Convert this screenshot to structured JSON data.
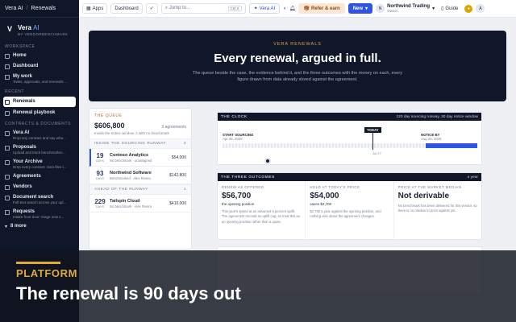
{
  "sidebar": {
    "header_app": "Vera AI",
    "header_page": "Renewals",
    "brand_name": "Vera",
    "brand_ai": "AI",
    "brand_sub": "BY VENDORBENCHMARK",
    "workspace_label": "WORKSPACE",
    "home": "Home",
    "dashboard": "Dashboard",
    "my_work": "My work",
    "my_work_desc": "Tasks, approvals, and renewals ...",
    "recent_label": "RECENT",
    "renewals": "Renewals",
    "renewal_playbook": "Renewal playbook",
    "contracts_label": "CONTRACTS & DOCUMENTS",
    "vera_ai": "Vera AI",
    "vera_ai_desc": "Drop any contract and say wha...",
    "proposals": "Proposals",
    "proposals_desc": "Upload and track benchmarkin...",
    "your_archive": "Your Archive",
    "your_archive_desc": "Drop every contract; Vera files t...",
    "agreements": "Agreements",
    "vendors": "Vendors",
    "document_search": "Document search",
    "document_search_desc": "Full-text search across your upl...",
    "requests": "Requests",
    "requests_desc": "Intake front door: triage new s...",
    "more": "8 more"
  },
  "topbar": {
    "apps": "Apps",
    "dashboard": "Dashboard",
    "search_placeholder": "Jump to...",
    "search_kbd": "Ctrl K",
    "vera_ai": "Vera AI",
    "refer": "Refer & earn",
    "new": "New",
    "org_initial": "N",
    "org_name": "Northwind Trading",
    "org_role": "Owner",
    "guide": "Guide",
    "user_initial": "A"
  },
  "hero": {
    "kicker": "VERA RENEWALS",
    "title": "Every renewal, argued in full.",
    "body": "The queue beside the case, the evidence behind it, and the three outcomes with the money on each, every figure drawn from data already stored against the agreement."
  },
  "queue": {
    "title": "THE QUEUE",
    "amount": "$606,800",
    "count": "3 agreements",
    "subtitle": "Inside the notice window, 2 with no benchmark",
    "group1": "INSIDE THE SOURCING RUNWAY",
    "group1_count": "2",
    "group2": "AHEAD OF THE RUNWAY",
    "group2_count": "1",
    "days_unit": "DAYS",
    "rows": [
      {
        "days": "19",
        "name": "Contoso Analytics",
        "status": "No benchmark · unassigned",
        "value": "$54,000"
      },
      {
        "days": "93",
        "name": "Northwind Software",
        "status": "Benchmarked · Alex Rivera",
        "value": "$142,800"
      },
      {
        "days": "229",
        "name": "Tailspin Cloud",
        "status": "No benchmark · Alex Rivera",
        "value": "$410,000"
      }
    ]
  },
  "clock": {
    "title": "THE CLOCK",
    "note": "120 day sourcing runway, 30 day notice window",
    "start_label": "START SOURCING",
    "start_date": "Apr 28, 2026",
    "today": "TODAY",
    "notice_label": "NOTICE BY",
    "notice_date": "Aug 26, 2026",
    "end_date": "Jul 27",
    "progress_fraction": 0.59
  },
  "outcomes": {
    "title": "THE THREE OUTCOMES",
    "note": "a year",
    "cols": [
      {
        "k": "RENEW AS OFFERED",
        "v": "$56,700",
        "s": "the opening position",
        "d": "This year's spend at an assumed 5 percent uplift. The agreement records no uplift cap, so treat this as an opening position rather than a quote."
      },
      {
        "k": "HOLD AT TODAY'S PRICE",
        "v": "$54,000",
        "s": "saves $2,700",
        "d": "$2,700 a year against the opening position, and nothing else about the agreement changes."
      },
      {
        "k": "PRICE AT THE MARKET MEDIAN",
        "v": "Not derivable",
        "s": "",
        "d": "No benchmark has been delivered for this vendor, so there is no median to price against yet."
      }
    ]
  },
  "overlay": {
    "kicker": "PLATFORM",
    "title": "The renewal is 90 days out"
  },
  "colors": {
    "navy": "#0f1728",
    "accent": "#2f55e4",
    "amber": "#e2a93b"
  }
}
